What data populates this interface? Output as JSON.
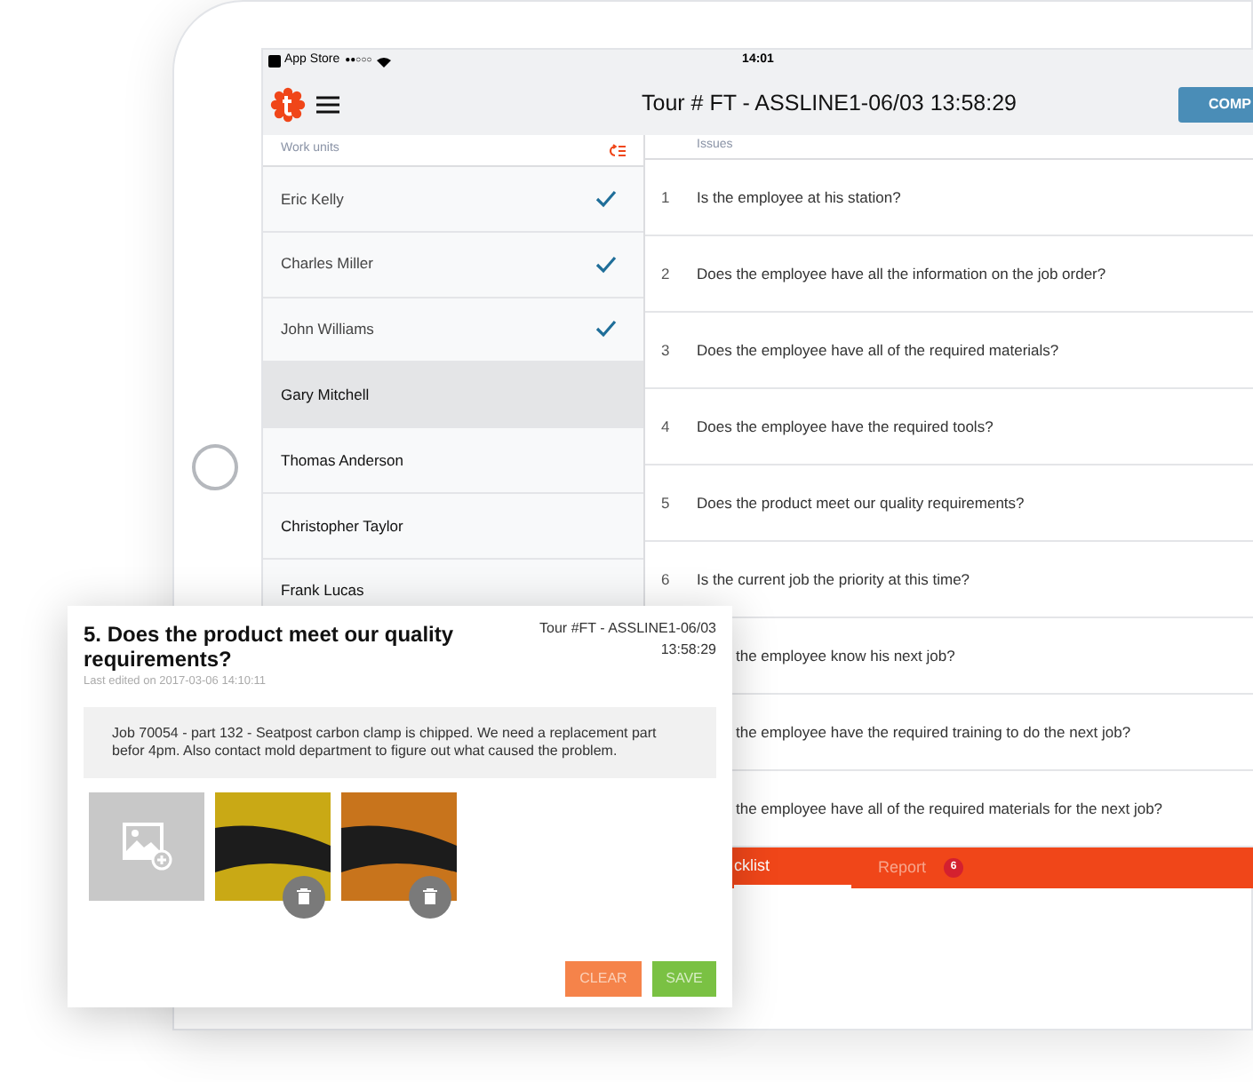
{
  "status_bar": {
    "carrier": "App Store",
    "signal_dots": "●●○○○",
    "time": "14:01"
  },
  "header": {
    "title": "Tour # FT - ASSLINE1-06/03 13:58:29",
    "action_button": "COMP"
  },
  "work_units": {
    "heading": "Work units",
    "items": [
      {
        "name": "Eric Kelly",
        "checked": true,
        "selected": false
      },
      {
        "name": "Charles Miller",
        "checked": true,
        "selected": false
      },
      {
        "name": "John Williams",
        "checked": true,
        "selected": false
      },
      {
        "name": "Gary Mitchell",
        "checked": false,
        "selected": true
      },
      {
        "name": "Thomas Anderson",
        "checked": false,
        "selected": false
      },
      {
        "name": "Christopher Taylor",
        "checked": false,
        "selected": false
      },
      {
        "name": "Frank Lucas",
        "checked": false,
        "selected": false
      }
    ]
  },
  "issues": {
    "heading": "Issues",
    "rows": [
      {
        "number": "1",
        "text": "Is the employee at his station?"
      },
      {
        "number": "2",
        "text": "Does the employee have all the information on the job order?"
      },
      {
        "number": "3",
        "text": "Does the employee have all of the required materials?"
      },
      {
        "number": "4",
        "text": "Does the employee have the required tools?"
      },
      {
        "number": "5",
        "text": "Does the product meet our quality requirements?"
      },
      {
        "number": "6",
        "text": "Is the current job the priority at this time?"
      },
      {
        "text": "the employee know his next job?"
      },
      {
        "text": "the employee have the required training to do the next job?"
      },
      {
        "text": "the employee have all of the required materials for the next job?"
      }
    ]
  },
  "tabs": [
    {
      "label": "cklist",
      "selected": true
    },
    {
      "label": "Report",
      "selected": false,
      "badge": "6"
    }
  ],
  "dialog": {
    "title": "5. Does the product meet our quality requirements?",
    "tour": "Tour #FT - ASSLINE1-06/03 13:58:29",
    "last_edited": "Last edited on 2017-03-06 14:10:11",
    "comment": "Job 70054 - part 132 - Seatpost carbon clamp is chipped. We need a replacement part befor 4pm. Also contact mold department to figure out what caused the problem.",
    "photos": [
      {
        "color": "#c9a915"
      },
      {
        "color": "#c8741c"
      }
    ],
    "buttons": [
      "CLEAR",
      "SAVE"
    ]
  }
}
